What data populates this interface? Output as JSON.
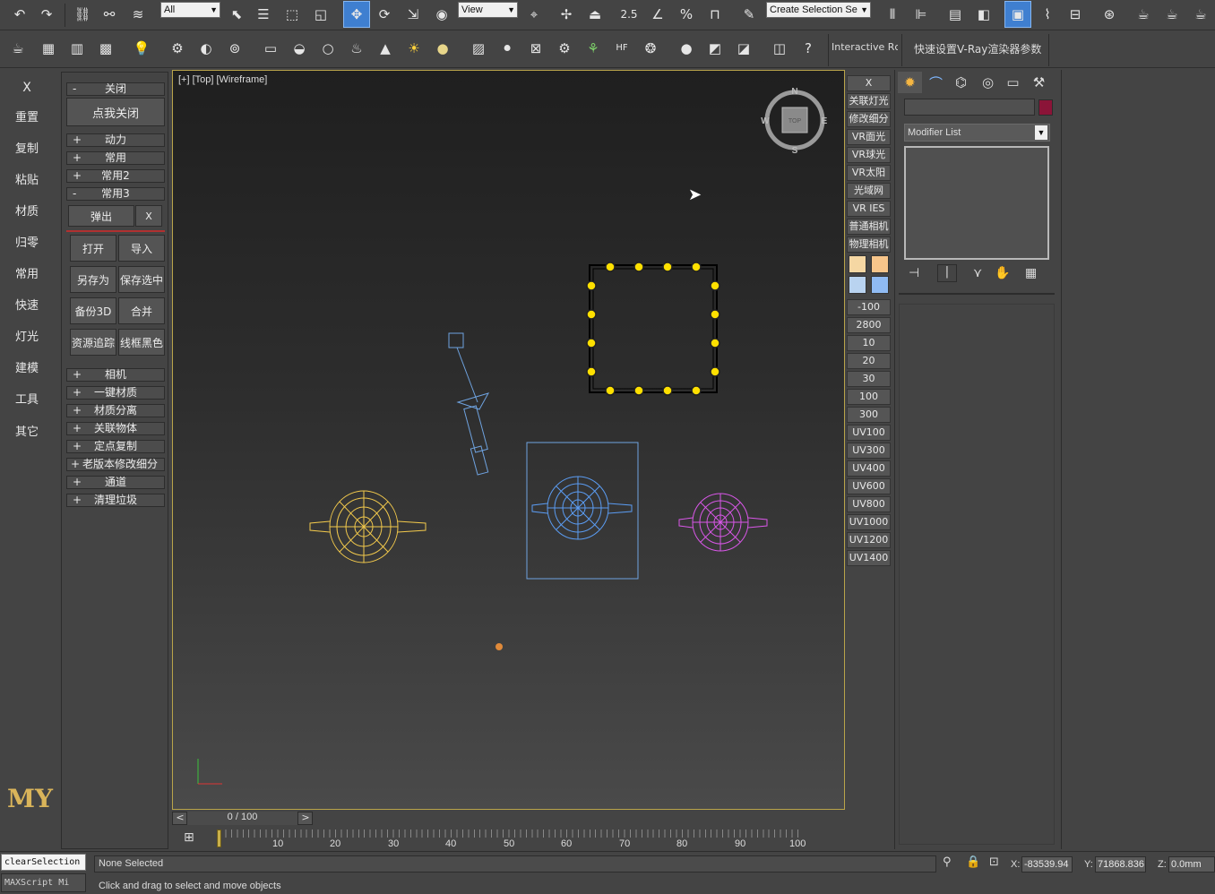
{
  "toolbar1": {
    "selection_filter": "All",
    "view_dropdown": "View",
    "snap_value": "2.5",
    "named_selection": "Create Selection Se"
  },
  "toolbar2": {
    "interactive_label": "Interactive Rc",
    "vray_quick_label": "快速设置V-Ray渲染器参数"
  },
  "left_nav": {
    "close": "X",
    "items": [
      "重置",
      "复制",
      "粘贴",
      "材质",
      "归零",
      "常用",
      "快速",
      "灯光",
      "建模",
      "工具",
      "其它"
    ],
    "logo": "MY"
  },
  "panel": {
    "rollout_close": {
      "sign": "-",
      "label": "关闭"
    },
    "close_me": "点我关闭",
    "rollouts_top": [
      {
        "sign": "+",
        "label": "动力"
      },
      {
        "sign": "+",
        "label": "常用"
      },
      {
        "sign": "+",
        "label": "常用2"
      },
      {
        "sign": "-",
        "label": "常用3"
      }
    ],
    "popup": "弹出",
    "popup_close": "X",
    "buttons": [
      "打开",
      "导入",
      "另存为",
      "保存选中",
      "备份3D",
      "合并",
      "资源追踪",
      "线框黑色"
    ],
    "rollouts_bottom": [
      {
        "sign": "+",
        "label": "相机"
      },
      {
        "sign": "+",
        "label": "一键材质"
      },
      {
        "sign": "+",
        "label": "材质分离"
      },
      {
        "sign": "+",
        "label": "关联物体"
      },
      {
        "sign": "+",
        "label": "定点复制"
      },
      {
        "sign": "+",
        "label": "老版本修改细分"
      },
      {
        "sign": "+",
        "label": "通道"
      },
      {
        "sign": "+",
        "label": "清理垃圾"
      }
    ]
  },
  "viewport": {
    "label": "[+] [Top] [Wireframe]",
    "compass": {
      "n": "N",
      "s": "S",
      "e": "E",
      "w": "W",
      "cube": "TOP"
    }
  },
  "right_strip": {
    "close": "X",
    "top_buttons": [
      "关联灯光",
      "修改细分",
      "VR面光",
      "VR球光",
      "VR太阳",
      "光域网",
      "VR IES",
      "普通相机",
      "物理相机"
    ],
    "swatches": [
      "#f5d7a3",
      "#f7c58a",
      "#b9d3f0",
      "#8fbaf2"
    ],
    "value_buttons": [
      "-100",
      "2800",
      "10",
      "20",
      "30",
      "100",
      "300",
      "UV100",
      "UV300",
      "UV400",
      "UV600",
      "UV800",
      "UV1000",
      "UV1200",
      "UV1400"
    ]
  },
  "command_panel": {
    "name_value": "",
    "color": "#8b1438",
    "modifier_list": "Modifier List"
  },
  "timeline": {
    "frame_readout": "0 / 100",
    "prev": "<",
    "next": ">",
    "ticks": [
      "10",
      "20",
      "30",
      "40",
      "50",
      "60",
      "70",
      "80",
      "90",
      "100"
    ]
  },
  "status": {
    "script_line1": "clearSelection",
    "script_line2": "MAXScript Mi",
    "selection": "None Selected",
    "prompt": "Click and drag to select and move objects",
    "x_label": "X:",
    "x_value": "-83539.94",
    "y_label": "Y:",
    "y_value": "71868.836",
    "z_label": "Z:",
    "z_value": "0.0mm"
  }
}
